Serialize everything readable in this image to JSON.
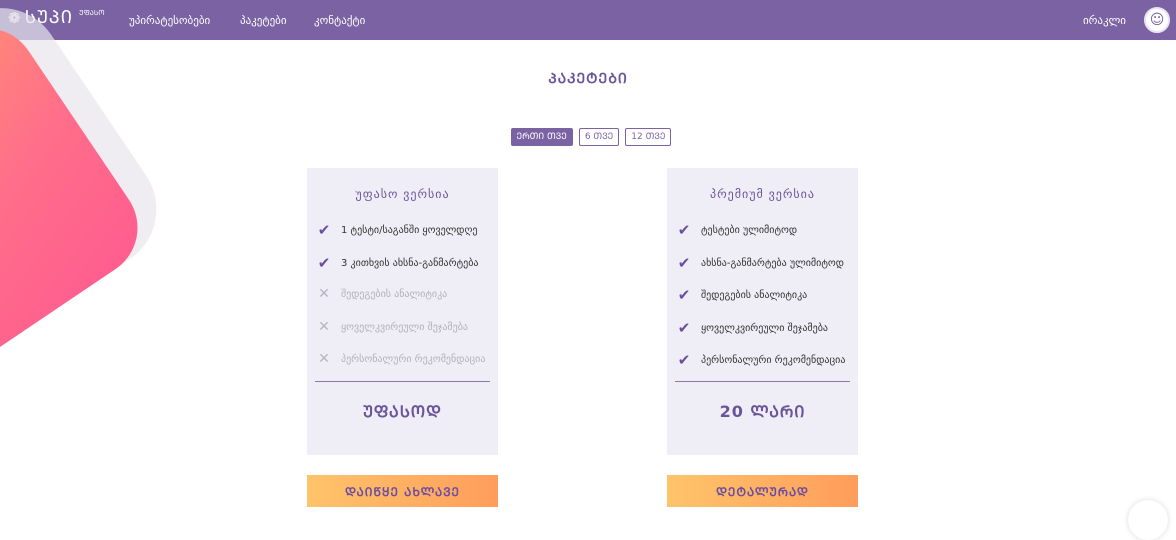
{
  "nav": {
    "logo_text": "ᲡᲣᲞᲘ",
    "logo_sub": "ᲣᲤᲐᲡᲝ",
    "links": [
      "უპირატესობები",
      "პაკეტები",
      "კონტაქტი"
    ],
    "user_name": "ირაკლი"
  },
  "page": {
    "title": "ᲞᲐᲙᲔᲢᲔᲑᲘ"
  },
  "periods": [
    {
      "label": "ᲔᲠᲗᲘ ᲗᲕᲔ",
      "active": true
    },
    {
      "label": "6 ᲗᲕᲔ",
      "active": false
    },
    {
      "label": "12 ᲗᲕᲔ",
      "active": false
    }
  ],
  "plans": {
    "free": {
      "title": "უფასო ვერსია",
      "features": [
        {
          "text": "1 ტესტი/საგანში ყოველდღე",
          "included": true
        },
        {
          "text": "3 კითხვის ახსნა-განმარტება",
          "included": true
        },
        {
          "text": "შედეგების ანალიტიკა",
          "included": false
        },
        {
          "text": "ყოველკვირეული შეჯამება",
          "included": false
        },
        {
          "text": "პერსონალური რეკომენდაცია",
          "included": false
        }
      ],
      "price": "ᲣᲤᲐᲡᲝᲓ",
      "button": "ᲓᲐᲘᲬᲧᲔ ᲐᲮᲚᲐᲕᲔ"
    },
    "premium": {
      "title": "პრემიუმ ვერსია",
      "features": [
        {
          "text": "ტესტები ულიმიტოდ",
          "included": true
        },
        {
          "text": "ახსნა-განმარტება ულიმიტოდ",
          "included": true
        },
        {
          "text": "შედეგების ანალიტიკა",
          "included": true
        },
        {
          "text": "ყოველკვირეული შეჯამება",
          "included": true
        },
        {
          "text": "პერსონალური რეკომენდაცია",
          "included": true
        }
      ],
      "price": "20 ᲚᲐᲠᲘ",
      "button": "ᲓᲔᲢᲐᲚᲣᲠᲐᲓ"
    }
  },
  "icons": {
    "check": "check-icon",
    "cross": "cross-icon",
    "avatar": "avatar-icon",
    "logo": "logo-icon",
    "chat": "chat-icon"
  },
  "colors": {
    "brand": "#7b62a3",
    "card_bg": "#efedf5",
    "button_start": "#ffc46a",
    "button_end": "#ff9d5c",
    "decoration": "#ff6f8a"
  }
}
